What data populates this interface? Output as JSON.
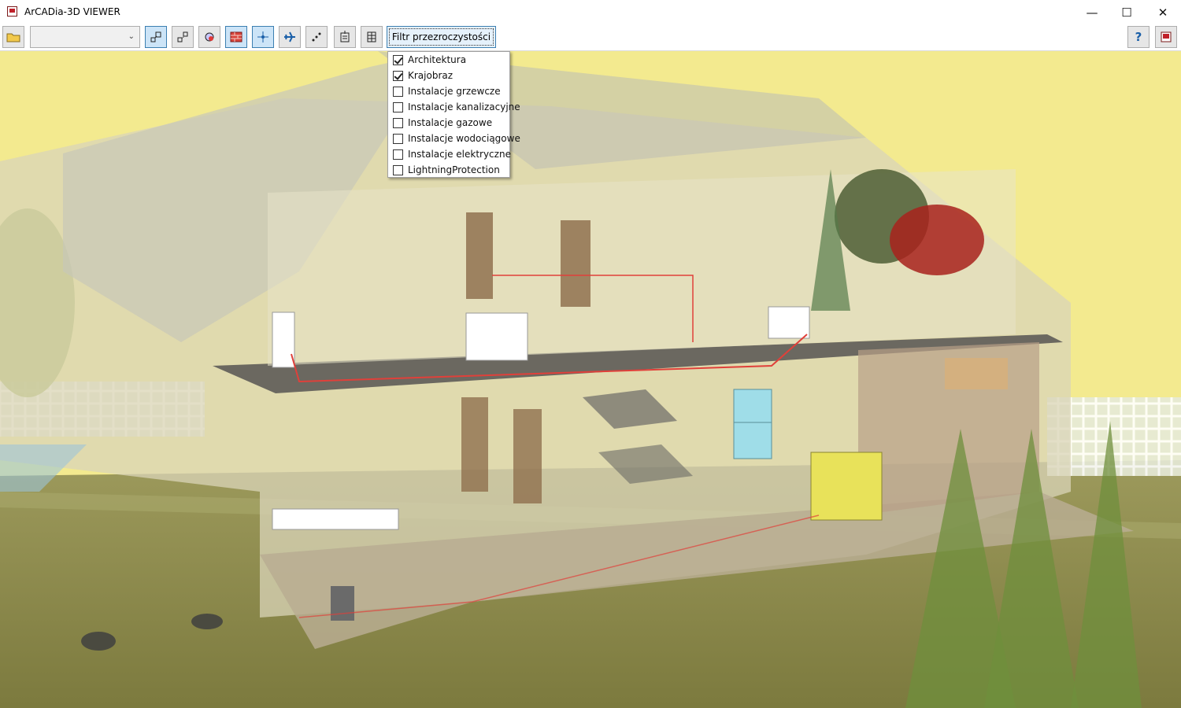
{
  "window": {
    "title": "ArCADia-3D VIEWER",
    "controls": {
      "minimize": "—",
      "maximize": "☐",
      "close": "✕"
    }
  },
  "toolbar": {
    "view_combo_value": "",
    "filter_button_label": "Filtr przezroczystości",
    "help_label": "?"
  },
  "filter_menu": {
    "items": [
      {
        "label": "Architektura",
        "checked": true
      },
      {
        "label": "Krajobraz",
        "checked": true
      },
      {
        "label": "Instalacje grzewcze",
        "checked": false
      },
      {
        "label": "Instalacje kanalizacyjne",
        "checked": false
      },
      {
        "label": "Instalacje gazowe",
        "checked": false
      },
      {
        "label": "Instalacje wodociągowe",
        "checked": false
      },
      {
        "label": "Instalacje elektryczne",
        "checked": false
      },
      {
        "label": "LightningProtection",
        "checked": false
      }
    ]
  },
  "colors": {
    "sky": "#f3ea8f",
    "grass": "#8f8f52",
    "accent": "#3c7fb1",
    "pipe": "#e0403a"
  }
}
